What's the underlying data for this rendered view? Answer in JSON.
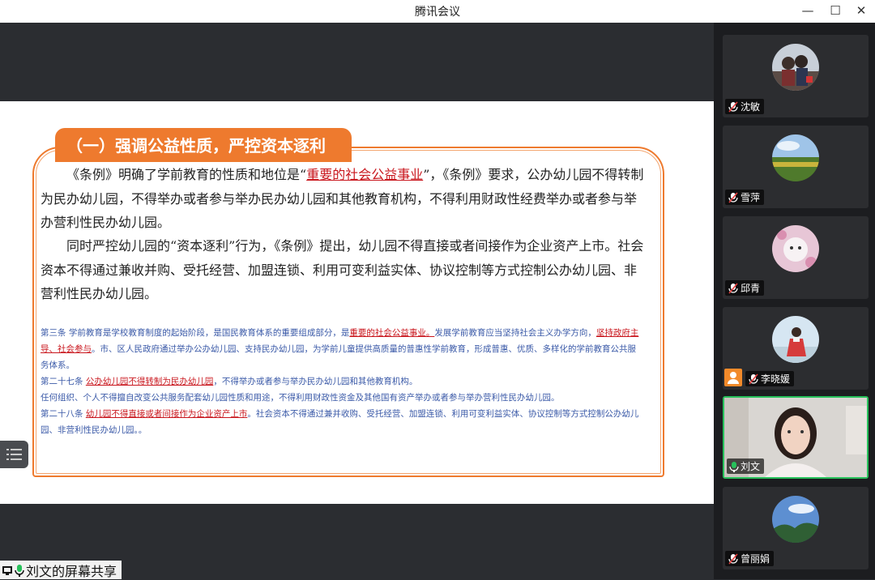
{
  "window": {
    "title": "腾讯会议",
    "minimize": "—",
    "maximize": "☐",
    "close": "✕"
  },
  "slide": {
    "section_title": "（一）强调公益性质，严控资本逐利",
    "para1": {
      "a": "《条例》明确了学前教育的性质和地位是“",
      "b": "重要的社会公益事业",
      "c": "”，《条例》要求，公办幼儿园不得转制为民办幼儿园，不得举办或者参与举办民办幼儿园和其他教育机构，不得利用财政性经费举办或者参与举办营利性民办幼儿园。"
    },
    "para2": "同时严控幼儿园的“资本逐利”行为，《条例》提出，幼儿园不得直接或者间接作为企业资产上市。社会资本不得通过兼收并购、受托经营、加盟连锁、利用可变利益实体、协议控制等方式控制公办幼儿园、非营利性民办幼儿园。",
    "articles": {
      "a3_1": "第三条  学前教育是学校教育制度的起始阶段，是国民教育体系的重要组成部分，是",
      "a3_red": "重要的社会公益事业。",
      "a3_2": "发展学前教育应当坚持社会主义办学方向，",
      "a3_red2": "坚持政府主导、社会参与",
      "a3_3": "。市、区人民政府通过举办公办幼儿园、支持民办幼儿园，为学前儿童提供高质量的普惠性学前教育，形成普惠、优质、多样化的学前教育公共服务体系。",
      "a27_1": "第二十七条  ",
      "a27_red": "公办幼儿园不得转制为民办幼儿园",
      "a27_2": "，不得举办或者参与举办民办幼儿园和其他教育机构。",
      "a27_3": "任何组织、个人不得擅自改变公共服务配套幼儿园性质和用途，不得利用财政性资金及其他国有资产举办或者参与举办营利性民办幼儿园。",
      "a28_1": "第二十八条  ",
      "a28_red": "幼儿园不得直接或者间接作为企业资产上市",
      "a28_2": "。社会资本不得通过兼并收购、受托经营、加盟连锁、利用可变利益实体、协议控制等方式控制公办幼儿园、非营利性民办幼儿园。。"
    }
  },
  "share_label": "刘文的屏幕共享",
  "participants": [
    {
      "name": "沈敏",
      "muted": true
    },
    {
      "name": "雪萍",
      "muted": true
    },
    {
      "name": "邱青",
      "muted": true
    },
    {
      "name": "李晓媛",
      "muted": true
    },
    {
      "name": "刘文",
      "muted": false
    },
    {
      "name": "曾丽娟",
      "muted": true
    }
  ],
  "colors": {
    "accent_orange": "#ee7a2e",
    "active_green": "#27c15b",
    "article_blue": "#3b5aa8",
    "highlight_red": "#c9161d"
  }
}
